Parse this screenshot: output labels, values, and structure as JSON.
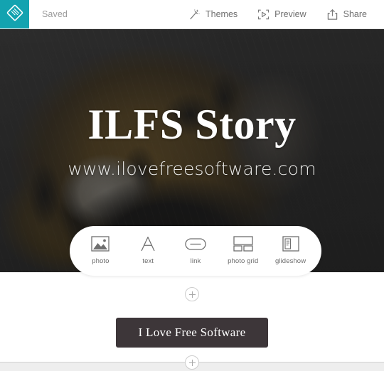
{
  "topbar": {
    "logo_icon": "document-diamond-logo-icon",
    "logo_color": "#13a3b0",
    "status_label": "Saved",
    "actions": [
      {
        "label": "Themes",
        "icon": "magic-wand-icon"
      },
      {
        "label": "Preview",
        "icon": "play-frame-icon"
      },
      {
        "label": "Share",
        "icon": "share-upload-icon"
      }
    ]
  },
  "hero": {
    "title": "ILFS Story",
    "subtitle": "www.ilovefreesoftware.com",
    "background_image": "tiger-photo",
    "background_color": "#343434"
  },
  "widget_picker": {
    "items": [
      {
        "label": "photo",
        "icon": "photo-icon"
      },
      {
        "label": "text",
        "icon": "text-a-icon"
      },
      {
        "label": "link",
        "icon": "link-pill-icon"
      },
      {
        "label": "photo grid",
        "icon": "photo-grid-icon"
      },
      {
        "label": "glideshow",
        "icon": "glideshow-icon"
      }
    ]
  },
  "canvas": {
    "add_block_top_icon": "plus-circle-icon",
    "add_block_bottom_icon": "plus-circle-icon",
    "cta_label": "I Love Free Software",
    "cta_color": "#3d3639",
    "bottom_text": ""
  }
}
